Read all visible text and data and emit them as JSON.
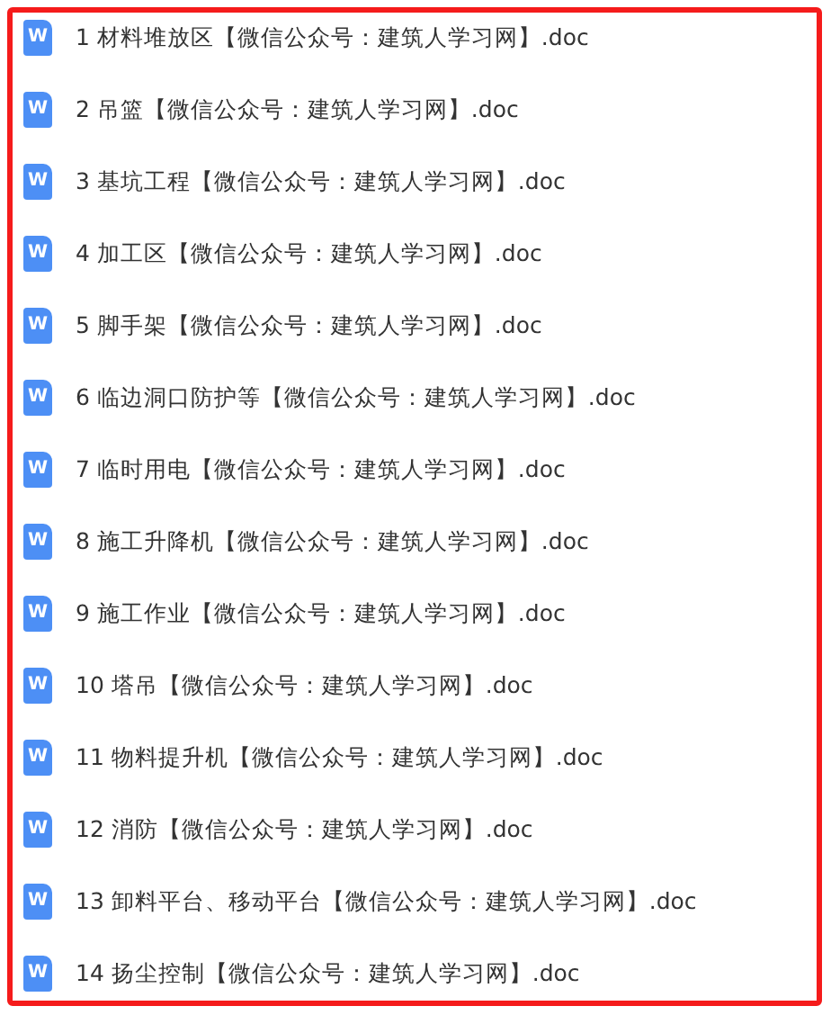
{
  "files": [
    {
      "icon": "W",
      "name": "1 材料堆放区【微信公众号：建筑人学习网】.doc"
    },
    {
      "icon": "W",
      "name": "2 吊篮【微信公众号：建筑人学习网】.doc"
    },
    {
      "icon": "W",
      "name": "3 基坑工程【微信公众号：建筑人学习网】.doc"
    },
    {
      "icon": "W",
      "name": "4 加工区【微信公众号：建筑人学习网】.doc"
    },
    {
      "icon": "W",
      "name": "5 脚手架【微信公众号：建筑人学习网】.doc"
    },
    {
      "icon": "W",
      "name": "6 临边洞口防护等【微信公众号：建筑人学习网】.doc"
    },
    {
      "icon": "W",
      "name": "7 临时用电【微信公众号：建筑人学习网】.doc"
    },
    {
      "icon": "W",
      "name": "8 施工升降机【微信公众号：建筑人学习网】.doc"
    },
    {
      "icon": "W",
      "name": "9 施工作业【微信公众号：建筑人学习网】.doc"
    },
    {
      "icon": "W",
      "name": "10 塔吊【微信公众号：建筑人学习网】.doc"
    },
    {
      "icon": "W",
      "name": "11 物料提升机【微信公众号：建筑人学习网】.doc"
    },
    {
      "icon": "W",
      "name": "12 消防【微信公众号：建筑人学习网】.doc"
    },
    {
      "icon": "W",
      "name": "13 卸料平台、移动平台【微信公众号：建筑人学习网】.doc"
    },
    {
      "icon": "W",
      "name": "14 扬尘控制【微信公众号：建筑人学习网】.doc"
    }
  ]
}
